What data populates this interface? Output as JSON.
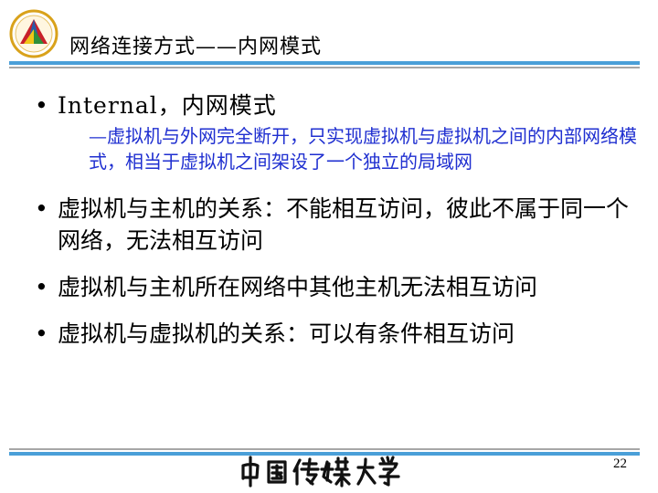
{
  "slide": {
    "title": "网络连接方式——内网模式",
    "page_number": "22"
  },
  "bullets": [
    {
      "text": "Internal，内网模式",
      "sub": "—虚拟机与外网完全断开，只实现虚拟机与虚拟机之间的内部网络模式，相当于虚拟机之间架设了一个独立的局域网"
    },
    {
      "text": "虚拟机与主机的关系：不能相互访问，彼此不属于同一个网络，无法相互访问"
    },
    {
      "text": "虚拟机与主机所在网络中其他主机无法相互访问"
    },
    {
      "text": "虚拟机与虚拟机的关系：可以有条件相互访问"
    }
  ],
  "bullet_symbol": "•",
  "footer": {
    "university_calligraphy": "中国传媒大学"
  },
  "colors": {
    "accent_blue": "#4a9fd8",
    "rule_gray": "#a6a6a6",
    "sub_text_blue": "#1f2fd0",
    "logo_red": "#c8202a",
    "logo_blue": "#2b5aa8",
    "logo_green": "#2f8f3a",
    "logo_gold": "#d9a21b"
  }
}
